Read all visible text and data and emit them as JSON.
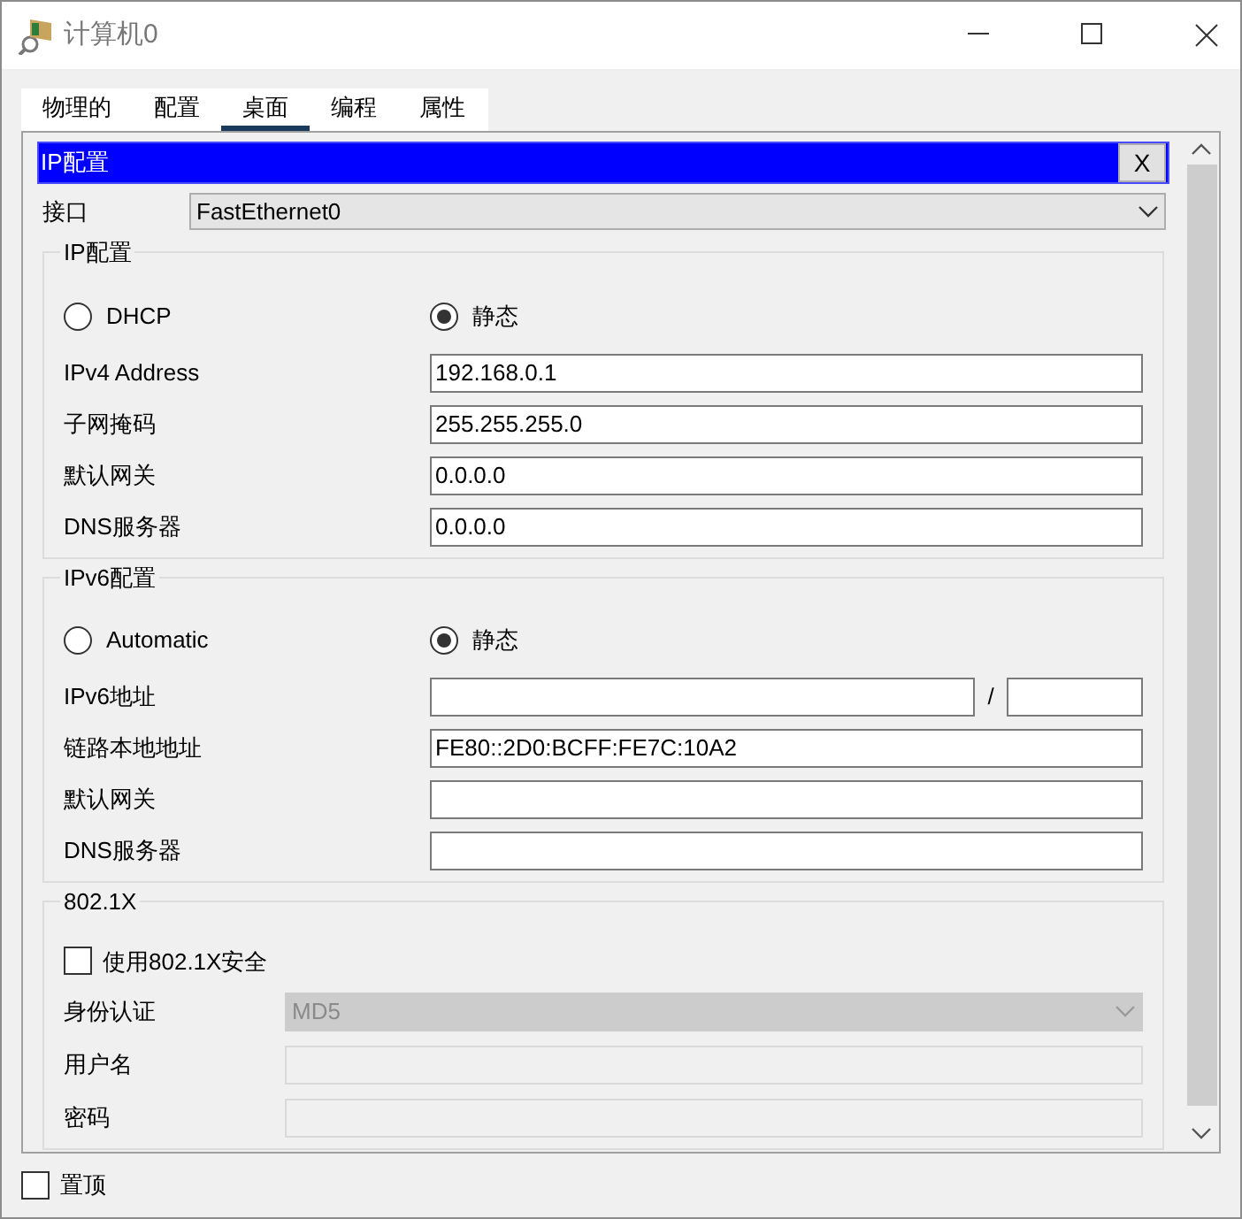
{
  "window": {
    "title": "计算机0"
  },
  "tabs": [
    {
      "label": "物理的",
      "selected": false
    },
    {
      "label": "配置",
      "selected": false
    },
    {
      "label": "桌面",
      "selected": true
    },
    {
      "label": "编程",
      "selected": false
    },
    {
      "label": "属性",
      "selected": false
    }
  ],
  "panel": {
    "title": "IP配置",
    "close": "X"
  },
  "interface": {
    "label": "接口",
    "value": "FastEthernet0"
  },
  "ipv4": {
    "legend": "IP配置",
    "modes": [
      {
        "label": "DHCP",
        "selected": false
      },
      {
        "label": "静态",
        "selected": true
      }
    ],
    "fields": [
      {
        "kind": "text",
        "label": "IPv4 Address",
        "value": "192.168.0.1"
      },
      {
        "kind": "text",
        "label": "子网掩码",
        "value": "255.255.255.0"
      },
      {
        "kind": "text",
        "label": "默认网关",
        "value": "0.0.0.0"
      },
      {
        "kind": "text",
        "label": "DNS服务器",
        "value": "0.0.0.0"
      }
    ]
  },
  "ipv6": {
    "legend": "IPv6配置",
    "modes": [
      {
        "label": "Automatic",
        "selected": false
      },
      {
        "label": "静态",
        "selected": true
      }
    ],
    "fields": [
      {
        "kind": "prefixed",
        "label": "IPv6地址",
        "separator": "/"
      },
      {
        "kind": "text",
        "label": "链路本地地址",
        "value": "FE80::2D0:BCFF:FE7C:10A2"
      },
      {
        "kind": "text",
        "label": "默认网关"
      },
      {
        "kind": "text",
        "label": "DNS服务器"
      }
    ]
  },
  "dot1x": {
    "legend": "802.1X",
    "enable": {
      "label": "使用802.1X安全",
      "checked": false
    },
    "fields": [
      {
        "kind": "select",
        "label": "身份认证",
        "value": "MD5",
        "disabled": true
      },
      {
        "kind": "text",
        "label": "用户名",
        "disabled": true
      },
      {
        "kind": "text",
        "label": "密码",
        "disabled": true
      }
    ]
  },
  "always_on_top": {
    "label": "置顶",
    "checked": false
  }
}
